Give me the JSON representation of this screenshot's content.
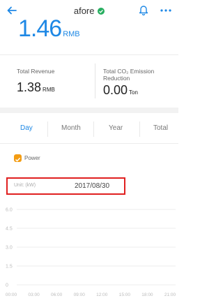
{
  "header": {
    "title": "afore",
    "icons": [
      "back-arrow-icon",
      "verified-check-icon",
      "bell-icon",
      "more-icon"
    ]
  },
  "summary": {
    "value": "1.46",
    "unit": "RMB"
  },
  "stats": {
    "revenue_label": "Total Revenue",
    "revenue_value": "1.38",
    "revenue_unit": "RMB",
    "emission_label": "Total CO₂ Emission Reduction",
    "emission_value": "0.00",
    "emission_unit": "Ton"
  },
  "tabs": [
    {
      "label": "Day",
      "active": true
    },
    {
      "label": "Month",
      "active": false
    },
    {
      "label": "Year",
      "active": false
    },
    {
      "label": "Total",
      "active": false
    }
  ],
  "legend": {
    "label": "Power",
    "color": "#f39c12",
    "checked": true
  },
  "chart_header": {
    "unit": "Unit: (kW)",
    "date": "2017/08/30"
  },
  "colors": {
    "accent": "#1e88e5",
    "highlight_border": "#e02020"
  },
  "chart_data": {
    "type": "line",
    "title": "",
    "xlabel": "",
    "ylabel": "Unit: (kW)",
    "ylim": [
      0,
      6.0
    ],
    "y_ticks": [
      "6.0",
      "4.5",
      "3.0",
      "1.5",
      "0"
    ],
    "x_ticks": [
      "00:00",
      "03:00",
      "06:00",
      "09:00",
      "12:00",
      "15:00",
      "18:00",
      "21:00"
    ],
    "series": [],
    "grid": true
  }
}
